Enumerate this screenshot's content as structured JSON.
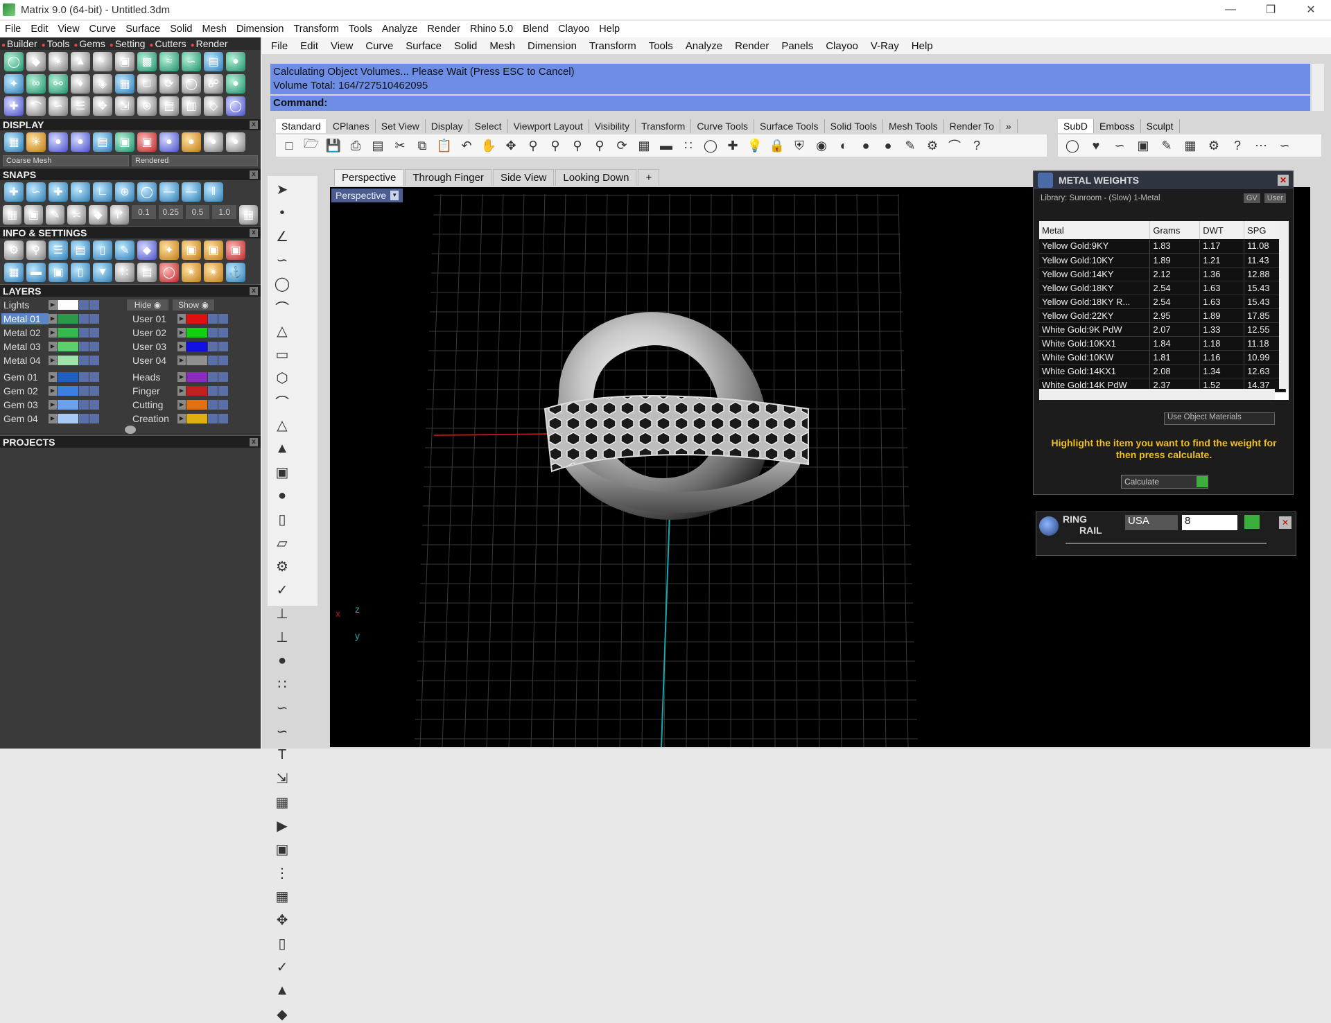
{
  "window": {
    "title": "Matrix 9.0 (64-bit) - Untitled.3dm"
  },
  "outer_menu": [
    "File",
    "Edit",
    "View",
    "Curve",
    "Surface",
    "Solid",
    "Mesh",
    "Dimension",
    "Transform",
    "Tools",
    "Analyze",
    "Render",
    "Rhino 5.0",
    "Blend",
    "Clayoo",
    "Help"
  ],
  "left_tabs": [
    "Builder",
    "Tools",
    "Gems",
    "Setting",
    "Cutters",
    "Render"
  ],
  "display": {
    "heading": "DISPLAY",
    "mesh_mode": "Coarse Mesh",
    "render_mode": "Rendered"
  },
  "snaps": {
    "heading": "SNAPS",
    "values": [
      "0.1",
      "0.25",
      "0.5",
      "1.0"
    ]
  },
  "info": {
    "heading": "INFO & SETTINGS"
  },
  "layers": {
    "heading": "LAYERS",
    "lights_label": "Lights",
    "hide_label": "Hide",
    "show_label": "Show",
    "left": [
      {
        "name": "Metal 01",
        "color": "#2a9a4a",
        "selected": true
      },
      {
        "name": "Metal 02",
        "color": "#36b84f"
      },
      {
        "name": "Metal 03",
        "color": "#5ccf6a"
      },
      {
        "name": "Metal 04",
        "color": "#9fe3a8"
      },
      {
        "name": "Gem 01",
        "color": "#1f5fbf"
      },
      {
        "name": "Gem 02",
        "color": "#3b7fe0"
      },
      {
        "name": "Gem 03",
        "color": "#6aa0ee"
      },
      {
        "name": "Gem 04",
        "color": "#a9c9f5"
      }
    ],
    "right": [
      {
        "name": "User 01",
        "color": "#e01010"
      },
      {
        "name": "User 02",
        "color": "#10d010"
      },
      {
        "name": "User 03",
        "color": "#1010e0"
      },
      {
        "name": "User 04",
        "color": "#909090"
      },
      {
        "name": "Heads",
        "color": "#8a2bbf"
      },
      {
        "name": "Finger",
        "color": "#c02020"
      },
      {
        "name": "Cutting",
        "color": "#e07010"
      },
      {
        "name": "Creation",
        "color": "#e0b010"
      }
    ]
  },
  "projects": {
    "heading": "PROJECTS"
  },
  "rhino_menu": [
    "File",
    "Edit",
    "View",
    "Curve",
    "Surface",
    "Solid",
    "Mesh",
    "Dimension",
    "Transform",
    "Tools",
    "Analyze",
    "Render",
    "Panels",
    "Clayoo",
    "V-Ray",
    "Help"
  ],
  "command": {
    "history_line1": "Calculating Object Volumes... Please Wait (Press ESC to Cancel)",
    "history_line2": "Volume Total: 164/727510462095",
    "prompt": "Command:"
  },
  "toolbar_tabs": [
    "Standard",
    "CPlanes",
    "Set View",
    "Display",
    "Select",
    "Viewport Layout",
    "Visibility",
    "Transform",
    "Curve Tools",
    "Surface Tools",
    "Solid Tools",
    "Mesh Tools",
    "Render To"
  ],
  "toolbar_tabs_more": "»",
  "toolbar_tabs2": [
    "SubD",
    "Emboss",
    "Sculpt"
  ],
  "viewport_tabs": [
    "Perspective",
    "Through Finger",
    "Side View",
    "Looking Down"
  ],
  "viewport_tab_add": "+",
  "viewport": {
    "label": "Perspective",
    "axis_x": "x",
    "axis_y": "y",
    "axis_z": "z"
  },
  "metal_weights": {
    "title": "METAL WEIGHTS",
    "library": "Library: Sunroom - (Slow) 1-Metal",
    "toggle_gv": "GV",
    "toggle_user": "User",
    "columns": [
      "Metal",
      "Grams",
      "DWT",
      "SPG"
    ],
    "rows": [
      [
        "Yellow Gold:9KY",
        "1.83",
        "1.17",
        "11.08"
      ],
      [
        "Yellow Gold:10KY",
        "1.89",
        "1.21",
        "11.43"
      ],
      [
        "Yellow Gold:14KY",
        "2.12",
        "1.36",
        "12.88"
      ],
      [
        "Yellow Gold:18KY",
        "2.54",
        "1.63",
        "15.43"
      ],
      [
        "Yellow Gold:18KY R...",
        "2.54",
        "1.63",
        "15.43"
      ],
      [
        "Yellow Gold:22KY",
        "2.95",
        "1.89",
        "17.85"
      ],
      [
        "White Gold:9K PdW",
        "2.07",
        "1.33",
        "12.55"
      ],
      [
        "White Gold:10KX1",
        "1.84",
        "1.18",
        "11.18"
      ],
      [
        "White Gold:10KW",
        "1.81",
        "1.16",
        "10.99"
      ],
      [
        "White Gold:14KX1",
        "2.08",
        "1.34",
        "12.63"
      ],
      [
        "White Gold:14K PdW",
        "2.37",
        "1.52",
        "14.37"
      ]
    ],
    "use_object_materials": "Use Object Materials",
    "hint": "Highlight the item you want to find the weight for then press calculate.",
    "calculate": "Calculate"
  },
  "ring_rail": {
    "title_line1": "RING",
    "title_line2": "RAIL",
    "country": "USA",
    "size": "8"
  }
}
